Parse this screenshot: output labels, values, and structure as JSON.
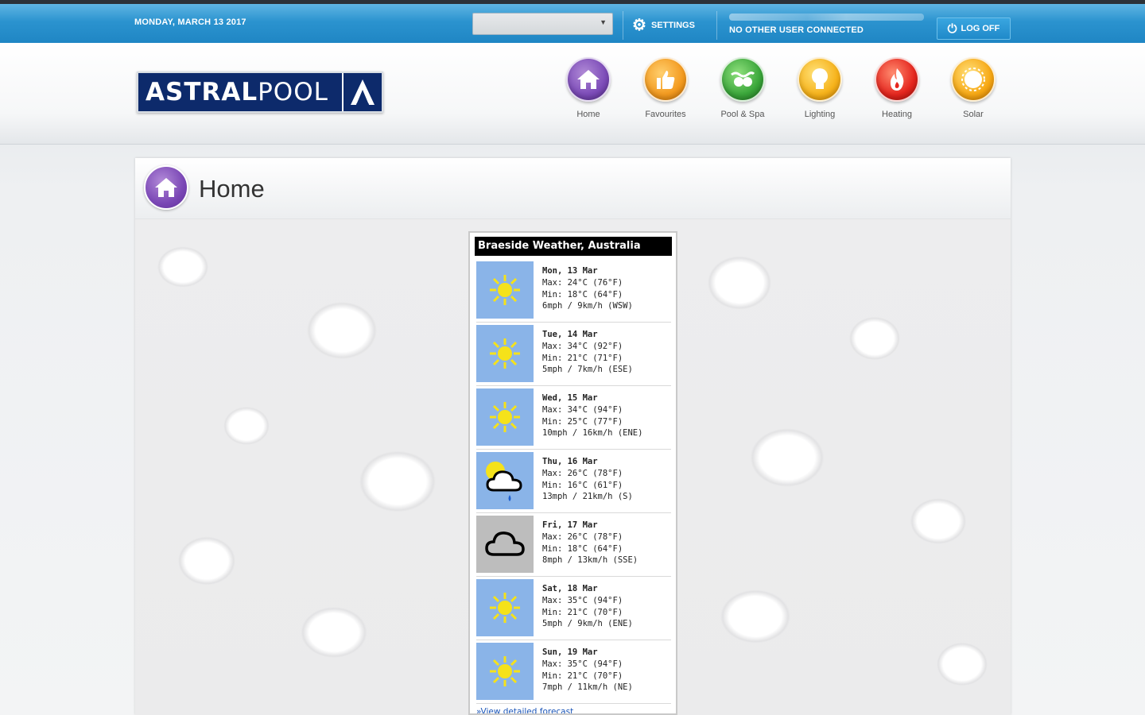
{
  "topbar": {
    "date": "MONDAY, MARCH 13 2017",
    "selector_value": "",
    "settings_label": "SETTINGS",
    "connection_status": "NO OTHER USER CONNECTED",
    "logoff_label": "LOG OFF"
  },
  "logo": {
    "text_bold": "ASTRAL",
    "text_thin": "POOL"
  },
  "nav": [
    {
      "label": "Home",
      "color": "#7c4bb8",
      "icon": "house-icon"
    },
    {
      "label": "Favourites",
      "color": "#f39a1f",
      "icon": "thumbs-up-icon"
    },
    {
      "label": "Pool & Spa",
      "color": "#3aa63a",
      "icon": "pool-icon"
    },
    {
      "label": "Lighting",
      "color": "#f6b21a",
      "icon": "lightbulb-icon"
    },
    {
      "label": "Heating",
      "color": "#e5261e",
      "icon": "flame-icon"
    },
    {
      "label": "Solar",
      "color": "#f7a814",
      "icon": "sun-icon"
    }
  ],
  "page": {
    "title": "Home"
  },
  "weather": {
    "title": "Braeside Weather, Australia",
    "days": [
      {
        "day": "Mon, 13 Mar",
        "max": "Max: 24°C (76°F)",
        "min": "Min: 18°C (64°F)",
        "wind": "6mph / 9km/h (WSW)",
        "icon": "sunny"
      },
      {
        "day": "Tue, 14 Mar",
        "max": "Max: 34°C (92°F)",
        "min": "Min: 21°C (71°F)",
        "wind": "5mph / 7km/h (ESE)",
        "icon": "sunny"
      },
      {
        "day": "Wed, 15 Mar",
        "max": "Max: 34°C (94°F)",
        "min": "Min: 25°C (77°F)",
        "wind": "10mph / 16km/h (ENE)",
        "icon": "sunny"
      },
      {
        "day": "Thu, 16 Mar",
        "max": "Max: 26°C (78°F)",
        "min": "Min: 16°C (61°F)",
        "wind": "13mph / 21km/h (S)",
        "icon": "sun-cloud-rain"
      },
      {
        "day": "Fri, 17 Mar",
        "max": "Max: 26°C (78°F)",
        "min": "Min: 18°C (64°F)",
        "wind": "8mph / 13km/h (SSE)",
        "icon": "cloudy"
      },
      {
        "day": "Sat, 18 Mar",
        "max": "Max: 35°C (94°F)",
        "min": "Min: 21°C (70°F)",
        "wind": "5mph / 9km/h (ENE)",
        "icon": "sunny"
      },
      {
        "day": "Sun, 19 Mar",
        "max": "Max: 35°C (94°F)",
        "min": "Min: 21°C (70°F)",
        "wind": "7mph / 11km/h (NE)",
        "icon": "sunny"
      }
    ],
    "more_link": "View detailed forecast"
  }
}
